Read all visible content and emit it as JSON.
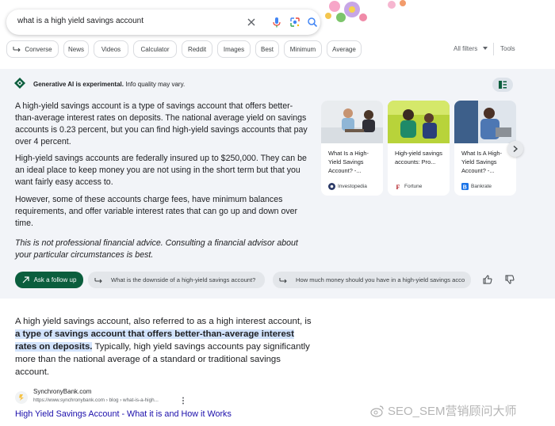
{
  "search": {
    "query": "what is a high yield savings account"
  },
  "chips": [
    {
      "label": "Converse"
    },
    {
      "label": "News"
    },
    {
      "label": "Videos"
    },
    {
      "label": "Calculator"
    },
    {
      "label": "Reddit"
    },
    {
      "label": "Images"
    },
    {
      "label": "Best"
    },
    {
      "label": "Minimum"
    },
    {
      "label": "Average"
    }
  ],
  "toolbar": {
    "all_filters": "All filters",
    "tools": "Tools"
  },
  "ai_overview": {
    "notice_bold": "Generative AI is experimental.",
    "notice_rest": "Info quality may vary.",
    "paragraphs": [
      "A high-yield savings account is a type of savings account that offers better-than-average interest rates on deposits. The national average yield on savings accounts is 0.23 percent, but you can find high-yield savings accounts that pay over 4 percent.",
      "High-yield savings accounts are federally insured up to $250,000. They can be an ideal place to keep money you are not using in the short term but that you want fairly easy access to.",
      "However, some of these accounts charge fees, have minimum balances requirements, and offer variable interest rates that can go up and down over time.",
      "This is not professional financial advice. Consulting a financial advisor about your particular circumstances is best."
    ],
    "cards": [
      {
        "title": "What Is a High-Yield Savings Account? -...",
        "source": "Investopedia"
      },
      {
        "title": "High-yield savings accounts: Pro...",
        "source": "Fortune"
      },
      {
        "title": "What Is A High-Yield Savings Account? -...",
        "source": "Bankrate"
      }
    ],
    "ask_button": "Ask a follow up",
    "suggestions": [
      "What is the downside of a high-yield savings account?",
      "How much money should you have in a high-yield savings acco"
    ]
  },
  "result": {
    "featured_pre": "A high yield savings account, also referred to as a high interest account, is ",
    "featured_highlight": "a type of savings account that offers better-than-average interest rates on deposits.",
    "featured_post": " Typically, high yield savings accounts pay significantly more than the national average of a standard or traditional savings account.",
    "site_name": "SynchronyBank.com",
    "site_url": "https://www.synchronybank.com › blog › what-is-a-high...",
    "title": "High Yield Savings Account - What it is and How it Works"
  },
  "watermark": "SEO_SEM营销顾问大师",
  "colors": {
    "accent_green": "#0b5e3d",
    "link": "#1a0dab",
    "panel_bg": "#f2f4f8",
    "highlight": "#d2e3fc"
  }
}
